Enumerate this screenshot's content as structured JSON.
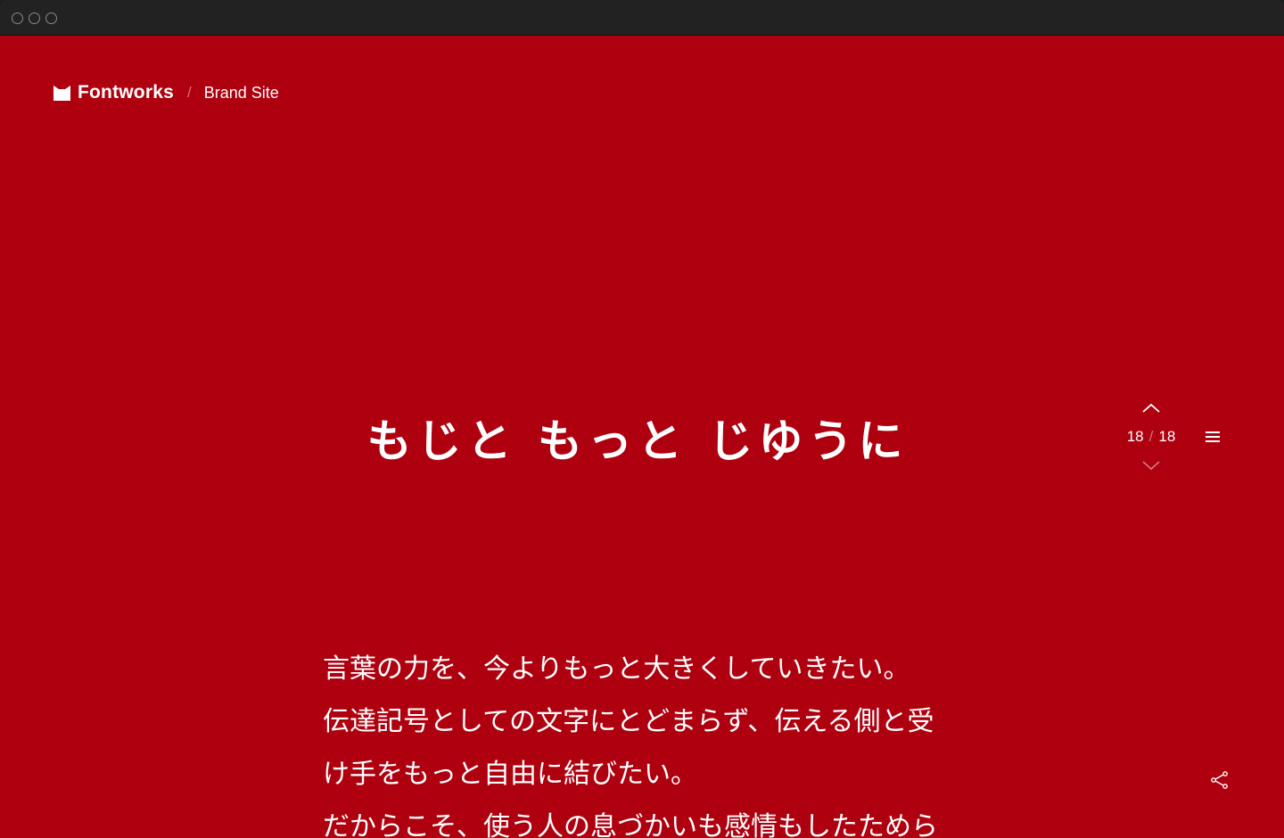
{
  "header": {
    "brand": "Fontworks",
    "separator": "/",
    "subtitle": "Brand Site"
  },
  "hero": {
    "headline": "もじと もっと じゆうに"
  },
  "pager": {
    "current": "18",
    "separator": "/",
    "total": "18"
  },
  "body": {
    "lines": [
      "言葉の力を、今よりもっと大きくしていきたい。",
      "伝達記号としての文字にとどまらず、伝える側と受",
      "け手をもっと自由に結びたい。",
      "だからこそ、使う人の息づかいも感情もしたためら"
    ]
  },
  "icons": {
    "logo": "fontworks-logo-icon",
    "up": "chevron-up-icon",
    "down": "chevron-down-icon",
    "menu": "hamburger-menu-icon",
    "share": "share-icon"
  },
  "colors": {
    "background": "#ae000f",
    "foreground": "#ffffff",
    "titlebar": "#222222"
  }
}
